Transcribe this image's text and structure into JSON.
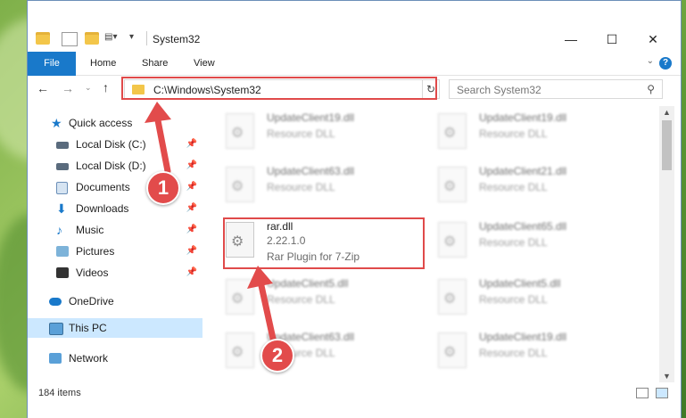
{
  "window": {
    "title": "System32"
  },
  "ribbon": {
    "tabs": [
      "File",
      "Home",
      "Share",
      "View"
    ],
    "help": "?"
  },
  "nav": {
    "address": "C:\\Windows\\System32",
    "search_placeholder": "Search System32"
  },
  "sidebar": {
    "items": [
      {
        "label": "Quick access",
        "pinned": false
      },
      {
        "label": "Local Disk (C:)",
        "pinned": true
      },
      {
        "label": "Local Disk (D:)",
        "pinned": true
      },
      {
        "label": "Documents",
        "pinned": true
      },
      {
        "label": "Downloads",
        "pinned": true
      },
      {
        "label": "Music",
        "pinned": true
      },
      {
        "label": "Pictures",
        "pinned": true
      },
      {
        "label": "Videos",
        "pinned": true
      },
      {
        "label": "OneDrive",
        "pinned": false
      },
      {
        "label": "This PC",
        "pinned": false,
        "selected": true
      },
      {
        "label": "Network",
        "pinned": false
      }
    ]
  },
  "files": [
    {
      "name": "UpdateClient19.dll",
      "sub": "Resource DLL"
    },
    {
      "name": "UpdateClient19.dll",
      "sub": "Resource DLL"
    },
    {
      "name": "UpdateClient63.dll",
      "sub": "Resource DLL"
    },
    {
      "name": "UpdateClient21.dll",
      "sub": "Resource DLL"
    },
    {
      "name": "rar.dll",
      "version": "2.22.1.0",
      "desc": "Rar Plugin for 7-Zip"
    },
    {
      "name": "UpdateClient65.dll",
      "sub": "Resource DLL"
    },
    {
      "name": "UpdateClient5.dll",
      "sub": "Resource DLL"
    },
    {
      "name": "UpdateClient5.dll",
      "sub": "Resource DLL"
    },
    {
      "name": "UpdateClient63.dll",
      "sub": "Resource DLL"
    },
    {
      "name": "UpdateClient19.dll",
      "sub": "Resource DLL"
    }
  ],
  "status": {
    "count": "184 items"
  },
  "callouts": {
    "one": "1",
    "two": "2"
  },
  "colors": {
    "accent": "#1979ca",
    "highlight": "#e04a4a"
  }
}
